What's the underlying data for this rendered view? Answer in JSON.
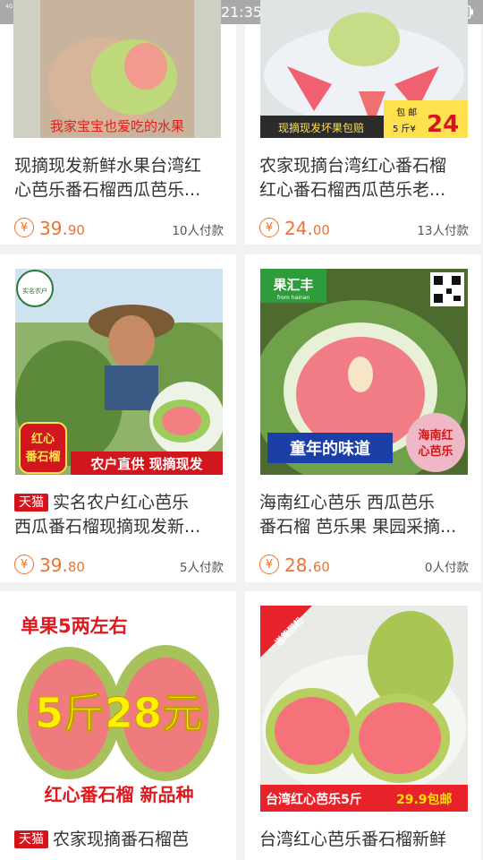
{
  "status_bar": {
    "time": "21:35",
    "signal1_label": "4G",
    "signal2_label": "2G"
  },
  "products": [
    {
      "title_line1": "现摘现发新鲜水果台湾红",
      "title_line2": "心芭乐番石榴西瓜芭乐...",
      "tmall": false,
      "price_int": "39.",
      "price_dec": "90",
      "sold": "10人付款",
      "image_caption": "我家宝宝也爱吃的水果"
    },
    {
      "title_line1": "农家现摘台湾红心番石榴",
      "title_line2": "红心番石榴西瓜芭乐老...",
      "tmall": false,
      "price_int": "24.",
      "price_dec": "00",
      "sold": "13人付款",
      "image_caption": "现摘现发坏果包赔",
      "image_badge_top": "包 邮",
      "image_badge_bottom": "5 斤¥",
      "image_badge_price": "24"
    },
    {
      "title_line1": "实名农户红心芭乐",
      "title_line2": "西瓜番石榴现摘现发新...",
      "tmall": true,
      "tmall_label": "天猫",
      "price_int": "39.",
      "price_dec": "80",
      "sold": "5人付款",
      "image_logo": "实名农户",
      "image_tag_1": "红心",
      "image_tag_2": "番石榴",
      "image_caption": "农户直供  现摘现发"
    },
    {
      "title_line1": "海南红心芭乐 西瓜芭乐",
      "title_line2": "番石榴 芭乐果 果园采摘...",
      "tmall": false,
      "price_int": "28.",
      "price_dec": "60",
      "sold": "0人付款",
      "image_brand": "果汇丰",
      "image_brand_sub": "from hainan",
      "image_caption": "童年的味道",
      "image_tag_1": "海南红",
      "image_tag_2": "心芭乐"
    },
    {
      "title_line1": "农家现摘番石榴芭",
      "title_line2": "",
      "tmall": true,
      "tmall_label": "天猫",
      "image_top": "单果5两左右",
      "image_price": "5斤28元",
      "image_caption": "红心番石榴  新品种"
    },
    {
      "title_line1": "台湾红心芭乐番石榴新鲜",
      "title_line2": "",
      "tmall": false,
      "image_corner": "送熊猫粉",
      "image_caption_a": "台湾红心芭乐5斤",
      "image_caption_b": "29.9包邮"
    }
  ],
  "colors": {
    "accent": "#f0712a",
    "tmall": "#d5131b",
    "background": "#f2f2f2"
  },
  "icons": [
    "yen-icon",
    "wifi-icon",
    "bell-off-icon",
    "battery-icon"
  ]
}
